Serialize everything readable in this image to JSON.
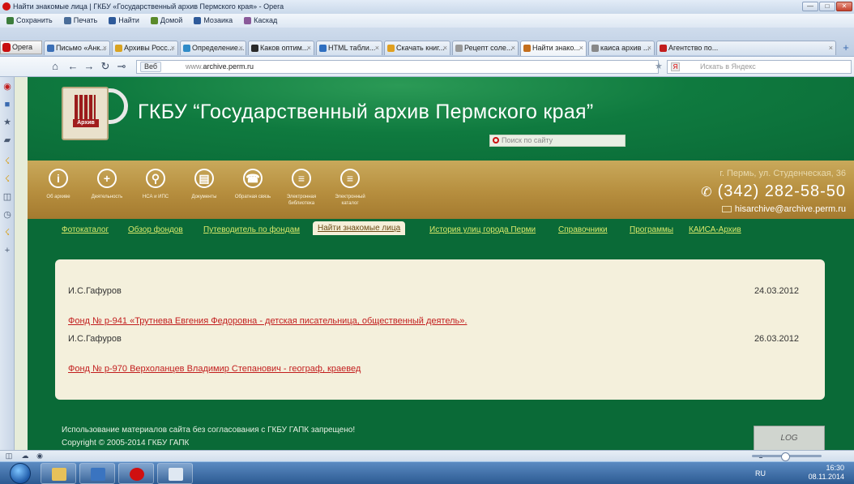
{
  "window": {
    "title": "Найти знакомые лица | ГКБУ «Государственный архив Пермского края» - Opera",
    "minimize": "—",
    "maximize": "□",
    "close": "✕"
  },
  "menubar": [
    {
      "label": "Сохранить",
      "icon": "save-icon",
      "color": "#3c7d3c"
    },
    {
      "label": "Печать",
      "icon": "print-icon",
      "color": "#4a6d99"
    },
    {
      "label": "Найти",
      "icon": "find-icon",
      "color": "#2e5a9a"
    },
    {
      "label": "Домой",
      "icon": "home-icon",
      "color": "#5a8a2a"
    },
    {
      "label": "Мозаика",
      "icon": "mosaic-icon",
      "color": "#2e5a9a"
    },
    {
      "label": "Каскад",
      "icon": "cascade-icon",
      "color": "#8a5a9a"
    }
  ],
  "browser_button": "Opera",
  "tabs": [
    {
      "label": "Письмо «Анк...",
      "color": "#3b6fb6"
    },
    {
      "label": "Архивы Росс...",
      "color": "#d9a321"
    },
    {
      "label": "Определение...",
      "color": "#2f8bc8"
    },
    {
      "label": "Каков оптим...",
      "color": "#2a2a2a"
    },
    {
      "label": "HTML табли...",
      "color": "#2f6fc0"
    },
    {
      "label": "Скачать книг...",
      "color": "#e0a020"
    },
    {
      "label": "Рецепт соле...",
      "color": "#999999"
    },
    {
      "label": "Найти знако...",
      "color": "#c46e1c",
      "active": true
    },
    {
      "label": "каиса архив ...",
      "color": "#888888"
    },
    {
      "label": "Агентство по...",
      "color": "#c21d1d"
    }
  ],
  "address": {
    "tag": "Веб",
    "prefix": "www.",
    "domain": "archive.perm.ru"
  },
  "search_placeholder": "Искать в Яндекс",
  "search_engine_letter": "Я",
  "site": {
    "logo_text": "Архив",
    "title": "ГКБУ “Государственный архив Пермского края”",
    "search_placeholder": "Поиск по сайту",
    "nav": [
      {
        "label": "Об архиве",
        "glyph": "i",
        "icon": "info-icon"
      },
      {
        "label": "Деятельность",
        "glyph": "+",
        "icon": "plus-icon"
      },
      {
        "label": "НСА и ИПС",
        "glyph": "⚲",
        "icon": "search-icon"
      },
      {
        "label": "Документы",
        "glyph": "▤",
        "icon": "document-icon"
      },
      {
        "label": "Обратная связь",
        "glyph": "☎",
        "icon": "feedback-icon"
      },
      {
        "label": "Электронная библиотека",
        "glyph": "≡",
        "icon": "library-icon"
      },
      {
        "label": "Электронный каталог",
        "glyph": "≡",
        "icon": "catalog-icon"
      }
    ],
    "address": "г. Пермь, ул. Студенческая, 36",
    "phone": "(342) 282-58-50",
    "email": "hisarchive@archive.perm.ru",
    "links": [
      {
        "label": "Фотокаталог"
      },
      {
        "label": "Обзор фондов"
      },
      {
        "label": "Путеводитель по фондам"
      },
      {
        "label": "Найти знакомые лица",
        "active": true
      },
      {
        "label": "История улиц города Перми"
      },
      {
        "label": "Справочники"
      },
      {
        "label": "Программы"
      },
      {
        "label": "КАИСА-Архив"
      }
    ],
    "entries": [
      {
        "author": "И.С.Гафуров",
        "date": "24.03.2012",
        "fond": "Фонд № р-941 «Трутнева Евгения Федоровна - детская писательница, общественный деятель»."
      },
      {
        "author": "И.С.Гафуров",
        "date": "26.03.2012",
        "fond": "Фонд № р-970 Верхоланцев Владимир Степанович - географ, краевед"
      }
    ],
    "footer_notice": "Использование материалов сайта без согласования с ГКБУ ГАПК запрещено!",
    "copyright": "Copyright © 2005-2014 ГКБУ ГАПК",
    "counter": "LOG"
  },
  "taskbar": {
    "lang": "RU",
    "time": "16:30",
    "date": "08.11.2014"
  }
}
